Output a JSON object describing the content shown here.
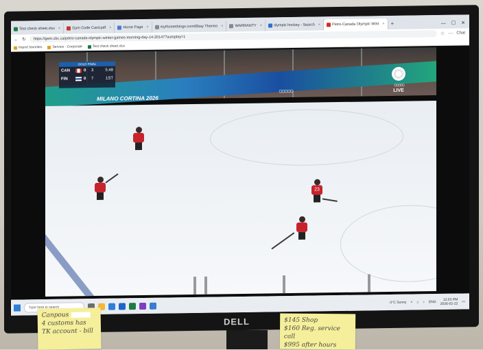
{
  "browser": {
    "tabs": [
      {
        "label": "Test check sheet.xlsx",
        "active": false
      },
      {
        "label": "Gym Code Card.pdf",
        "active": false
      },
      {
        "label": "Home Page",
        "active": false
      },
      {
        "label": "mythomethings.com/Ebay Thermo",
        "active": false
      },
      {
        "label": "WARRANTY",
        "active": false
      },
      {
        "label": "olympic hockey - Search",
        "active": false
      },
      {
        "label": "Petro-Canada Olympic Wint",
        "active": true
      }
    ],
    "new_tab": "+",
    "url": "https://gem.cbc.ca/petro-canada-olympic-winter-games-morning-day-14-20147?autoplay=1",
    "bookmarks": [
      "Import favorites",
      "Service - Corporate",
      "Test check sheet.xlsx"
    ],
    "profile_label": "Chat"
  },
  "video": {
    "scorebug": {
      "header": "GOLD FINAL",
      "teams": [
        {
          "code": "CAN",
          "score": "0",
          "shots": "3"
        },
        {
          "code": "FIN",
          "score": "0",
          "shots": "7"
        }
      ],
      "clock": "5:48",
      "period": "1ST"
    },
    "boards_text": "MILANO CORTINA 2026",
    "live_label": "LIVE",
    "jersey_number": "23"
  },
  "taskbar": {
    "search_placeholder": "Type here to search",
    "weather": "-3°C Sunny",
    "language": "ENG",
    "time": "12:03 PM",
    "date": "2026-02-22"
  },
  "monitor": {
    "brand": "DELL"
  },
  "notes": {
    "left": [
      "Canpous",
      "4 customs has",
      "TK account - bill"
    ],
    "right": [
      "$145 Shop",
      "$160 Reg. service call",
      "$995 after hours"
    ]
  }
}
